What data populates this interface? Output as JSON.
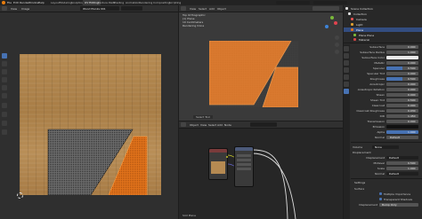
{
  "menu": {
    "items": [
      "File",
      "Edit",
      "Render",
      "Window",
      "Help"
    ]
  },
  "workspace_tabs": {
    "items": [
      "Layout",
      "Modeling",
      "Sculpting",
      "UV Editing",
      "Texture Paint",
      "Shading",
      "Animation",
      "Rendering",
      "Compositing",
      "Scripting"
    ],
    "active": "UV Editing"
  },
  "image_editor": {
    "image_name": "Wood Planks 001",
    "view_menus": [
      "View",
      "Image"
    ]
  },
  "viewport": {
    "overlay_lines": [
      "Top Orthographic",
      "(1) Plane",
      "10 Centimeters",
      "Rendering Done"
    ],
    "status": "Select Tool",
    "menus": [
      "View",
      "Select",
      "Add",
      "Object"
    ]
  },
  "node_editor": {
    "menus": [
      "Object",
      "View",
      "Select",
      "Add",
      "Node"
    ],
    "label": "Principled BSDF",
    "footer_label": "Slot Plane",
    "node_names": [
      "Image Texture",
      "Mapping",
      "Principled BSDF"
    ]
  },
  "outliner": {
    "rows": [
      "Scene Collection",
      "Collection",
      "Camera",
      "Light",
      "Plane",
      "Plane Plane",
      "Material"
    ]
  },
  "properties": {
    "rows": [
      {
        "label": "Subsurface",
        "value": "0.000"
      },
      {
        "label": "Subsurface Radius",
        "value": "1.000"
      },
      {
        "label": "Subsurface Color",
        "value": ""
      },
      {
        "label": "Metallic",
        "value": "0.000"
      },
      {
        "label": "Specular",
        "value": "0.500"
      },
      {
        "label": "Specular Tint",
        "value": "0.000"
      },
      {
        "label": "Roughness",
        "value": "0.500"
      },
      {
        "label": "Anisotropic",
        "value": "0.000"
      },
      {
        "label": "Anisotropic Rotation",
        "value": "0.000"
      },
      {
        "label": "Sheen",
        "value": "0.000"
      },
      {
        "label": "Sheen Tint",
        "value": "0.500"
      },
      {
        "label": "Clearcoat",
        "value": "0.000"
      },
      {
        "label": "Clearcoat Roughness",
        "value": "0.030"
      },
      {
        "label": "IOR",
        "value": "1.450"
      },
      {
        "label": "Transmission",
        "value": "0.000"
      },
      {
        "label": "Emission",
        "value": ""
      },
      {
        "label": "Alpha",
        "value": "1.000"
      },
      {
        "label": "Normal",
        "value": "Default"
      }
    ],
    "lower_rows": [
      {
        "label": "Volume",
        "value": "None"
      },
      {
        "label": "Displacement",
        "value": ""
      },
      {
        "label": "Displacement",
        "value": "Default"
      },
      {
        "label": "Midlevel",
        "value": "0.500"
      },
      {
        "label": "Scale",
        "value": "1.000"
      },
      {
        "label": "Normal",
        "value": "Default"
      }
    ],
    "settings_title": "Settings",
    "settings_rows": [
      {
        "label": "Surface",
        "value": ""
      },
      {
        "label": "Multiple Importance",
        "value": ""
      },
      {
        "label": "Transparent Shadows",
        "value": ""
      },
      {
        "label": "Displacement",
        "value": "Bump Only"
      }
    ]
  },
  "colors": {
    "orange": "#e2731b",
    "accent": "#4772b3",
    "panel": "#2b2b2b"
  }
}
